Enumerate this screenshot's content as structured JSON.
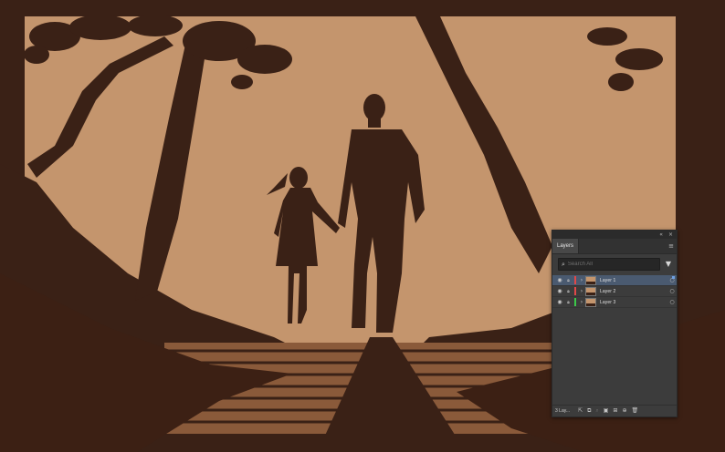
{
  "artwork": {
    "colors": {
      "sky": "#c4956d",
      "silhouette": "#3a2116",
      "foreground": "#3c2014",
      "path_light": "#8a5a3a"
    }
  },
  "layers_panel": {
    "titlebar": {
      "collapse_glyph": "«",
      "close_glyph": "×"
    },
    "tab_label": "Layers",
    "menu_glyph": "≡",
    "search": {
      "placeholder": "Search All",
      "icon": "search-icon"
    },
    "filter_glyph": "▼",
    "layers": [
      {
        "name": "Layer 1",
        "color": "#e04848",
        "selected": true
      },
      {
        "name": "Layer 2",
        "color": "#e04848",
        "selected": false
      },
      {
        "name": "Layer 3",
        "color": "#3cc84a",
        "selected": false
      }
    ],
    "footer": {
      "count_label": "3 Lay...",
      "icons": [
        "export-icon",
        "collect-icon",
        "locate-icon",
        "clip-mask-icon",
        "new-sublayer-icon",
        "new-layer-icon",
        "delete-icon"
      ]
    }
  }
}
